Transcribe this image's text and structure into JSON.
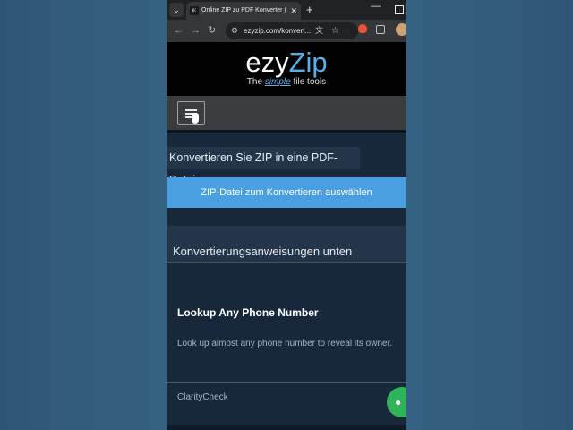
{
  "browser": {
    "tab_favicon": "e:",
    "tab_title": "Online ZIP zu PDF Konverter (K",
    "tab_close": "✕",
    "new_tab": "+",
    "minimize": "—",
    "url": "ezyzip.com/konvert...",
    "icons": [
      "chevron-down-icon",
      "back-icon",
      "forward-icon",
      "reload-icon",
      "tune-icon",
      "translate-icon",
      "star-icon",
      "extension-icon",
      "puzzle-icon",
      "avatar"
    ]
  },
  "site": {
    "logo_ezy": "ezy",
    "logo_zip": "Zip",
    "tagline_pre": "The ",
    "tagline_simple": "simple",
    "tagline_post": " file tools",
    "brand_colors": {
      "accent": "#5aaee6",
      "button": "#4a9fe0",
      "panel": "#223549"
    }
  },
  "main": {
    "title": "Konvertieren Sie ZIP in eine PDF-Datei",
    "select_button": "ZIP-Datei zum Konvertieren auswählen",
    "instructions": "Konvertierungsanweisungen unten"
  },
  "ad": {
    "title": "Lookup Any Phone Number",
    "description": "Look up almost any phone number to reveal its owner.",
    "brand": "ClarityCheck"
  }
}
